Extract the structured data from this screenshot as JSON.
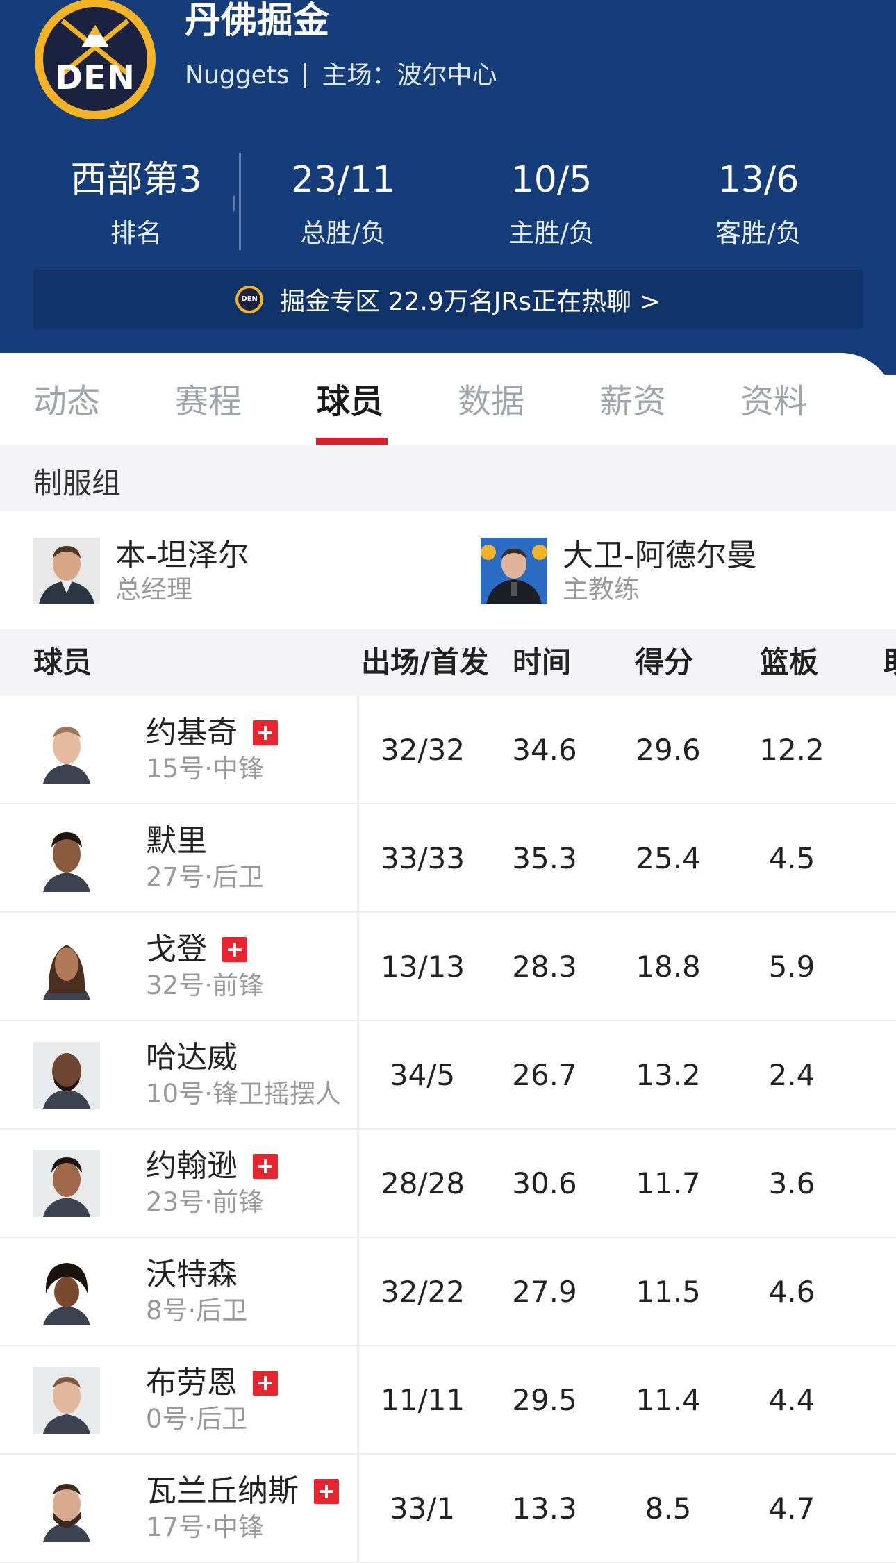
{
  "team": {
    "logo_text": "DEN",
    "name": "丹佛掘金",
    "english_name": "Nuggets",
    "arena_label": "主场：",
    "arena": "波尔中心"
  },
  "stats": [
    {
      "value": "西部第3",
      "label": "排名"
    },
    {
      "value": "23/11",
      "label": "总胜/负"
    },
    {
      "value": "10/5",
      "label": "主胜/负"
    },
    {
      "value": "13/6",
      "label": "客胜/负"
    }
  ],
  "forum": {
    "mini_logo": "DEN",
    "text": "掘金专区 22.9万名JRs正在热聊 >"
  },
  "tabs": [
    "动态",
    "赛程",
    "球员",
    "数据",
    "薪资",
    "资料"
  ],
  "active_tab": "球员",
  "staff_section": {
    "title": "制服组",
    "members": [
      {
        "name": "本-坦泽尔",
        "role": "总经理"
      },
      {
        "name": "大卫-阿德尔曼",
        "role": "主教练"
      }
    ]
  },
  "table": {
    "headers": [
      "球员",
      "出场/首发",
      "时间",
      "得分",
      "篮板",
      "助"
    ],
    "rows": [
      {
        "name": "约基奇",
        "info": "15号·中锋",
        "injured": true,
        "gp": "32/32",
        "min": "34.6",
        "pts": "29.6",
        "reb": "12.2"
      },
      {
        "name": "默里",
        "info": "27号·后卫",
        "injured": false,
        "gp": "33/33",
        "min": "35.3",
        "pts": "25.4",
        "reb": "4.5"
      },
      {
        "name": "戈登",
        "info": "32号·前锋",
        "injured": true,
        "gp": "13/13",
        "min": "28.3",
        "pts": "18.8",
        "reb": "5.9"
      },
      {
        "name": "哈达威",
        "info": "10号·锋卫摇摆人",
        "injured": false,
        "gp": "34/5",
        "min": "26.7",
        "pts": "13.2",
        "reb": "2.4"
      },
      {
        "name": "约翰逊",
        "info": "23号·前锋",
        "injured": true,
        "gp": "28/28",
        "min": "30.6",
        "pts": "11.7",
        "reb": "3.6"
      },
      {
        "name": "沃特森",
        "info": "8号·后卫",
        "injured": false,
        "gp": "32/22",
        "min": "27.9",
        "pts": "11.5",
        "reb": "4.6"
      },
      {
        "name": "布劳恩",
        "info": "0号·后卫",
        "injured": true,
        "gp": "11/11",
        "min": "29.5",
        "pts": "11.4",
        "reb": "4.4"
      },
      {
        "name": "瓦兰丘纳斯",
        "info": "17号·中锋",
        "injured": true,
        "gp": "33/1",
        "min": "13.3",
        "pts": "8.5",
        "reb": "4.7"
      }
    ]
  },
  "colors": {
    "header_bg": "#143d7a",
    "accent_red": "#d5202a",
    "injury_red": "#e8242f",
    "logo_gold": "#f3b324"
  }
}
